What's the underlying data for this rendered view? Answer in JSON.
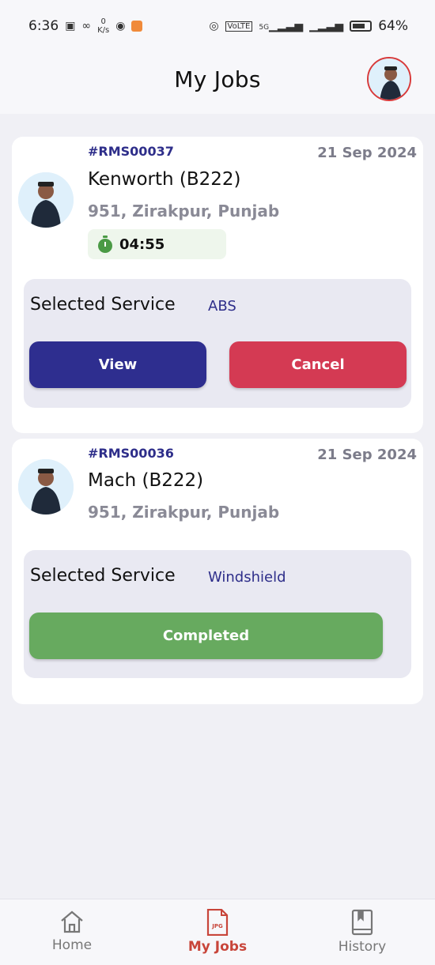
{
  "status_bar": {
    "time": "6:36",
    "net_speed_value": "0",
    "net_speed_unit": "K/s",
    "battery": "64%",
    "network": "5G",
    "volte": "VoLTE"
  },
  "header": {
    "title": "My Jobs"
  },
  "jobs": [
    {
      "id": "#RMS00037",
      "date": "21 Sep 2024",
      "vehicle": "Kenworth (B222)",
      "address": "951, Zirakpur, Punjab",
      "timer": "04:55",
      "service_label": "Selected Service",
      "service_value": "ABS",
      "view_label": "View",
      "cancel_label": "Cancel"
    },
    {
      "id": "#RMS00036",
      "date": "21 Sep 2024",
      "vehicle": "Mach (B222)",
      "address": "951, Zirakpur, Punjab",
      "service_label": "Selected Service",
      "service_value": "Windshield",
      "completed_label": "Completed"
    }
  ],
  "bottom_nav": {
    "items": [
      {
        "label": "Home",
        "icon": "home-icon"
      },
      {
        "label": "My Jobs",
        "icon": "jpg-file-icon",
        "icon_text": "JPG",
        "active": true
      },
      {
        "label": "History",
        "icon": "book-icon"
      }
    ]
  },
  "colors": {
    "accent_blue": "#2e2e8f",
    "cancel_red": "#d43a53",
    "complete_green": "#67aa5f",
    "active_nav": "#c8453a"
  }
}
